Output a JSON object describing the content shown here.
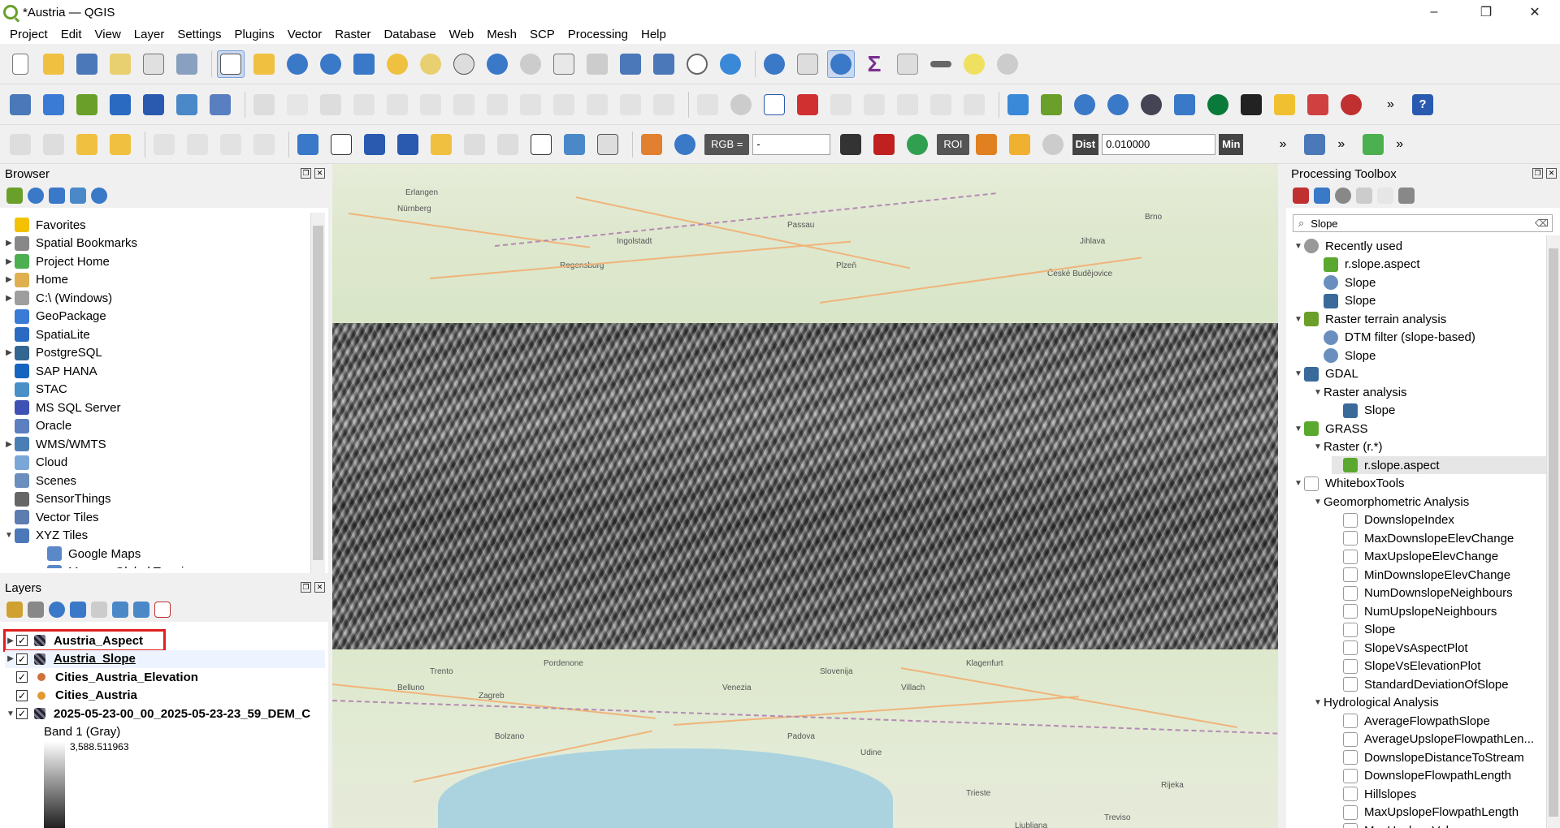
{
  "window": {
    "title": "*Austria — QGIS",
    "minimize": "–",
    "maximize": "❐",
    "close": "✕"
  },
  "menu": [
    "Project",
    "Edit",
    "View",
    "Layer",
    "Settings",
    "Plugins",
    "Vector",
    "Raster",
    "Database",
    "Web",
    "Mesh",
    "SCP",
    "Processing",
    "Help"
  ],
  "toolbar3": {
    "rgb_label": "RGB =",
    "rgb_value": "-",
    "roi_label": "ROI",
    "dist_label": "Dist",
    "dist_value": "0.010000",
    "min_label": "Min"
  },
  "browser": {
    "title": "Browser",
    "items": [
      {
        "label": "Favorites",
        "expand": "",
        "icon": "star-icon",
        "color": "#f2c200"
      },
      {
        "label": "Spatial Bookmarks",
        "expand": "▶",
        "icon": "bookmark-icon",
        "color": "#888888"
      },
      {
        "label": "Project Home",
        "expand": "▶",
        "icon": "project-home-icon",
        "color": "#4caf50"
      },
      {
        "label": "Home",
        "expand": "▶",
        "icon": "folder-icon",
        "color": "#e0b050"
      },
      {
        "label": "C:\\ (Windows)",
        "expand": "▶",
        "icon": "drive-icon",
        "color": "#9e9e9e"
      },
      {
        "label": "GeoPackage",
        "expand": "",
        "icon": "geopackage-icon",
        "color": "#3a7bd5"
      },
      {
        "label": "SpatiaLite",
        "expand": "",
        "icon": "spatialite-icon",
        "color": "#2a6ac0"
      },
      {
        "label": "PostgreSQL",
        "expand": "▶",
        "icon": "postgresql-icon",
        "color": "#336791"
      },
      {
        "label": "SAP HANA",
        "expand": "",
        "icon": "sap-hana-icon",
        "color": "#1565c0"
      },
      {
        "label": "STAC",
        "expand": "",
        "icon": "stac-icon",
        "color": "#4a90c8"
      },
      {
        "label": "MS SQL Server",
        "expand": "",
        "icon": "mssql-icon",
        "color": "#3f51b5"
      },
      {
        "label": "Oracle",
        "expand": "",
        "icon": "oracle-icon",
        "color": "#5b7fbf"
      },
      {
        "label": "WMS/WMTS",
        "expand": "▶",
        "icon": "wms-icon",
        "color": "#4a7fb5"
      },
      {
        "label": "Cloud",
        "expand": "",
        "icon": "cloud-icon",
        "color": "#7aa7d8"
      },
      {
        "label": "Scenes",
        "expand": "",
        "icon": "scenes-icon",
        "color": "#6a8fbf"
      },
      {
        "label": "SensorThings",
        "expand": "",
        "icon": "sensorthings-icon",
        "color": "#666666"
      },
      {
        "label": "Vector Tiles",
        "expand": "",
        "icon": "vector-tiles-icon",
        "color": "#5d7cb0"
      },
      {
        "label": "XYZ Tiles",
        "expand": "▼",
        "icon": "xyz-tiles-icon",
        "color": "#4a78b8"
      },
      {
        "label": "Google Maps",
        "expand": "",
        "icon": "tile-layer-icon",
        "color": "#5a88c8",
        "indent": 1
      },
      {
        "label": "Mapzen Global Terrain",
        "expand": "",
        "icon": "tile-layer-icon",
        "color": "#5a88c8",
        "indent": 1
      }
    ]
  },
  "layers": {
    "title": "Layers",
    "items": [
      {
        "label": "Austria_Aspect",
        "checked": "✓",
        "expand": "▶",
        "icon": "raster-layer-icon",
        "bold": true,
        "highlight": true
      },
      {
        "label": "Austria_Slope",
        "checked": "✓",
        "expand": "▶",
        "icon": "raster-layer-icon",
        "bold": true,
        "underline": true
      },
      {
        "label": "Cities_Austria_Elevation",
        "checked": "✓",
        "expand": "",
        "icon": "point-layer-icon",
        "bold": true
      },
      {
        "label": "Cities_Austria",
        "checked": "✓",
        "expand": "",
        "icon": "point-layer-icon",
        "bold": true
      },
      {
        "label": "2025-05-23-00_00_2025-05-23-23_59_DEM_C",
        "checked": "✓",
        "expand": "▼",
        "icon": "raster-layer-icon",
        "bold": true
      }
    ],
    "band_label": "Band 1 (Gray)",
    "legend_max": "3,588.511963"
  },
  "toolbox": {
    "title": "Processing Toolbox",
    "search_value": "Slope",
    "items": [
      {
        "label": "Recently used",
        "level": 0,
        "expand": "▼",
        "icon": "clock-icon"
      },
      {
        "label": "r.slope.aspect",
        "level": 1,
        "expand": "",
        "icon": "grass-icon"
      },
      {
        "label": "Slope",
        "level": 1,
        "expand": "",
        "icon": "gear-icon"
      },
      {
        "label": "Slope",
        "level": 1,
        "expand": "",
        "icon": "gdal-icon"
      },
      {
        "label": "Raster terrain analysis",
        "level": 0,
        "expand": "▼",
        "icon": "qgis-icon"
      },
      {
        "label": "DTM filter (slope-based)",
        "level": 1,
        "expand": "",
        "icon": "gear-icon"
      },
      {
        "label": "Slope",
        "level": 1,
        "expand": "",
        "icon": "gear-icon"
      },
      {
        "label": "GDAL",
        "level": 0,
        "expand": "▼",
        "icon": "gdal-icon"
      },
      {
        "label": "Raster analysis",
        "level": 1,
        "expand": "▼",
        "icon": ""
      },
      {
        "label": "Slope",
        "level": 2,
        "expand": "",
        "icon": "gdal-icon"
      },
      {
        "label": "GRASS",
        "level": 0,
        "expand": "▼",
        "icon": "grass-icon"
      },
      {
        "label": "Raster (r.*)",
        "level": 1,
        "expand": "▼",
        "icon": ""
      },
      {
        "label": "r.slope.aspect",
        "level": 2,
        "expand": "",
        "icon": "grass-icon",
        "selected": true
      },
      {
        "label": "WhiteboxTools",
        "level": 0,
        "expand": "▼",
        "icon": "whitebox-icon"
      },
      {
        "label": "Geomorphometric Analysis",
        "level": 1,
        "expand": "▼",
        "icon": ""
      },
      {
        "label": "DownslopeIndex",
        "level": 2,
        "expand": "",
        "icon": "whitebox-icon"
      },
      {
        "label": "MaxDownslopeElevChange",
        "level": 2,
        "expand": "",
        "icon": "whitebox-icon"
      },
      {
        "label": "MaxUpslopeElevChange",
        "level": 2,
        "expand": "",
        "icon": "whitebox-icon"
      },
      {
        "label": "MinDownslopeElevChange",
        "level": 2,
        "expand": "",
        "icon": "whitebox-icon"
      },
      {
        "label": "NumDownslopeNeighbours",
        "level": 2,
        "expand": "",
        "icon": "whitebox-icon"
      },
      {
        "label": "NumUpslopeNeighbours",
        "level": 2,
        "expand": "",
        "icon": "whitebox-icon"
      },
      {
        "label": "Slope",
        "level": 2,
        "expand": "",
        "icon": "whitebox-icon"
      },
      {
        "label": "SlopeVsAspectPlot",
        "level": 2,
        "expand": "",
        "icon": "whitebox-icon"
      },
      {
        "label": "SlopeVsElevationPlot",
        "level": 2,
        "expand": "",
        "icon": "whitebox-icon"
      },
      {
        "label": "StandardDeviationOfSlope",
        "level": 2,
        "expand": "",
        "icon": "whitebox-icon"
      },
      {
        "label": "Hydrological Analysis",
        "level": 1,
        "expand": "▼",
        "icon": ""
      },
      {
        "label": "AverageFlowpathSlope",
        "level": 2,
        "expand": "",
        "icon": "whitebox-icon"
      },
      {
        "label": "AverageUpslopeFlowpathLen...",
        "level": 2,
        "expand": "",
        "icon": "whitebox-icon"
      },
      {
        "label": "DownslopeDistanceToStream",
        "level": 2,
        "expand": "",
        "icon": "whitebox-icon"
      },
      {
        "label": "DownslopeFlowpathLength",
        "level": 2,
        "expand": "",
        "icon": "whitebox-icon"
      },
      {
        "label": "Hillslopes",
        "level": 2,
        "expand": "",
        "icon": "whitebox-icon"
      },
      {
        "label": "MaxUpslopeFlowpathLength",
        "level": 2,
        "expand": "",
        "icon": "whitebox-icon"
      },
      {
        "label": "MaxUpslopeValue",
        "level": 2,
        "expand": "",
        "icon": "whitebox-icon"
      }
    ]
  },
  "map": {
    "labels": [
      "Nürnberg",
      "Erlangen",
      "Regensburg",
      "Passau",
      "Ingolstadt",
      "Plzeň",
      "České Budějovice",
      "Jihlava",
      "Brno",
      "Klagenfurt",
      "Villach",
      "Ljubljana",
      "Slovenija",
      "Udine",
      "Trieste",
      "Venezia",
      "Padova",
      "Treviso",
      "Rijeka",
      "Zagreb",
      "Pordenone",
      "Belluno",
      "Trento",
      "Bolzano"
    ]
  },
  "colors": {
    "accent": "#c9d9ef",
    "highlight": "#e02020",
    "selected_row": "#e6e6e6"
  }
}
